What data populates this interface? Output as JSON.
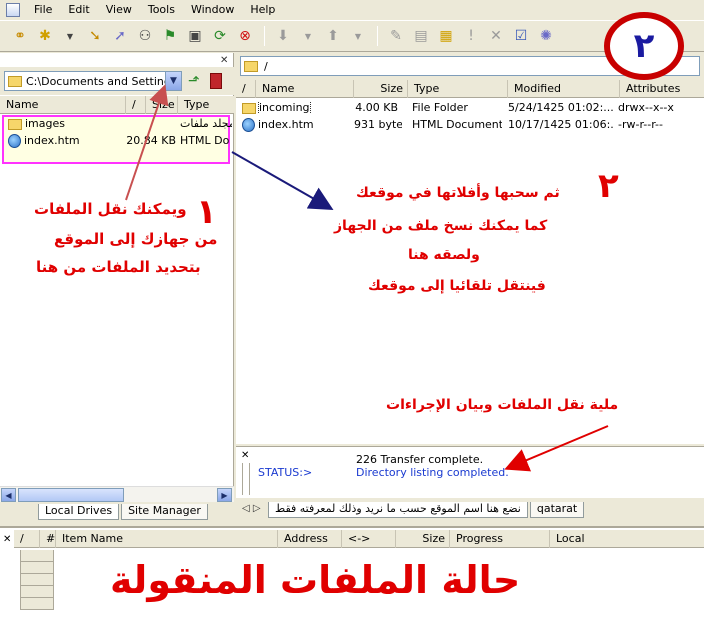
{
  "menu": {
    "items": [
      "File",
      "Edit",
      "View",
      "Tools",
      "Window",
      "Help"
    ]
  },
  "badge": {
    "text": "٢"
  },
  "left": {
    "path": "C:\\Documents and Settings\\",
    "columns": {
      "name": "Name",
      "slash": "/",
      "size": "Size",
      "type": "Type"
    },
    "files": [
      {
        "name": "images",
        "size": "",
        "type": "مجلد ملفات",
        "icon": "folder-icon"
      },
      {
        "name": "index.htm",
        "size": "20.84 KB",
        "type": "HTML Do",
        "icon": "html-file-icon"
      }
    ],
    "tabs": [
      "Local Drives",
      "Site Manager"
    ]
  },
  "right": {
    "path": "/",
    "columns": {
      "name": "Name",
      "size": "Size",
      "type": "Type",
      "modified": "Modified",
      "attributes": "Attributes"
    },
    "files": [
      {
        "name": "incoming",
        "size": "4.00 KB",
        "type": "File Folder",
        "modified": "5/24/1425 01:02:...",
        "attributes": "drwx--x--x",
        "icon": "folder-icon"
      },
      {
        "name": "index.htm",
        "size": "931 bytes",
        "type": "HTML Document",
        "modified": "10/17/1425 01:06:...",
        "attributes": "-rw-r--r--",
        "icon": "html-file-icon"
      }
    ],
    "tabs": [
      "نضع هنا اسم الموقع حسب ما نريد وذلك لمعرفته فقط",
      "qatarat"
    ]
  },
  "status": {
    "line1": "226 Transfer complete.",
    "label": "STATUS:>",
    "line2": "Directory listing completed."
  },
  "queue": {
    "columns": {
      "slash": "/",
      "hash": "#",
      "item_name": "Item Name",
      "address": "Address",
      "direction": "<->",
      "size": "Size",
      "progress": "Progress",
      "local": "Local"
    }
  },
  "annotations": {
    "one": "١",
    "two": "٢",
    "left_lines": [
      "ويمكنك نقل الملفات",
      "من جهازك إلى الموقع",
      "بتحديد الملفات من هنا"
    ],
    "right_lines": [
      "ثم سحبها وأفلاتها في موقعك",
      "كما يمكنك نسخ ملف من الجهاز",
      "ولصقه هنا",
      "فينتقل تلقائيا إلى موقعك"
    ],
    "status_note": "ملية نقل الملفات وبيان الإجراءات",
    "queue_title": "حالة الملفات المنقولة"
  },
  "colors": {
    "annotation_red": "#e00000",
    "highlight_border": "#ff33ff",
    "arrow_blue": "#1a1a7a",
    "status_blue": "#1a3ad0"
  }
}
